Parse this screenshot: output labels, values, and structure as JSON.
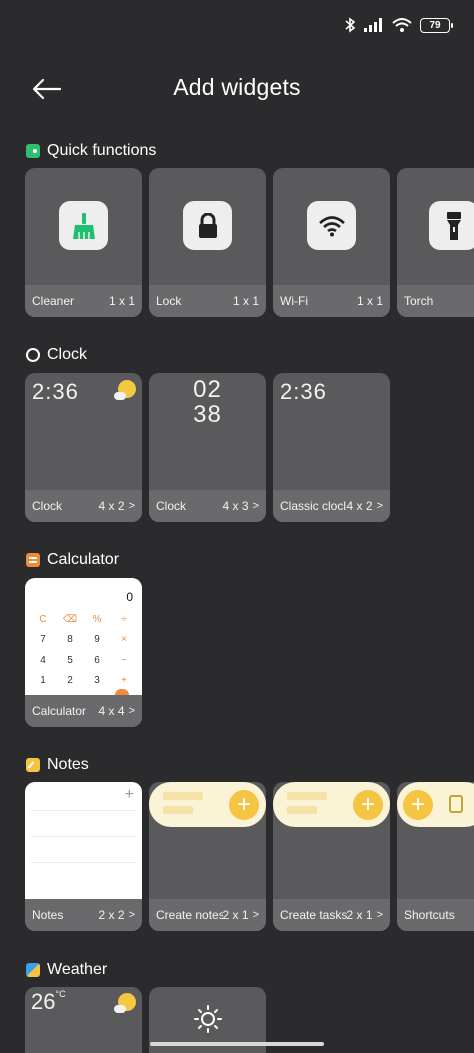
{
  "status_bar": {
    "battery": "79"
  },
  "header": {
    "title": "Add widgets"
  },
  "sections": {
    "quick": {
      "title": "Quick functions",
      "icon_color": "#2fbf71"
    },
    "clock": {
      "title": "Clock"
    },
    "calculator": {
      "title": "Calculator",
      "icon_color": "#f08a3c"
    },
    "notes": {
      "title": "Notes",
      "icon_color": "#f6c443"
    },
    "weather": {
      "title": "Weather"
    }
  },
  "quick_widgets": [
    {
      "name": "Cleaner",
      "size": "1 x 1",
      "icon": "broom-icon"
    },
    {
      "name": "Lock",
      "size": "1 x 1",
      "icon": "lock-icon"
    },
    {
      "name": "Wi-Fi",
      "size": "1 x 1",
      "icon": "wifi-icon"
    },
    {
      "name": "Torch",
      "size": "",
      "icon": "torch-icon"
    }
  ],
  "clock_widgets": [
    {
      "name": "Clock",
      "size": "4 x 2",
      "time": "2:36"
    },
    {
      "name": "Clock",
      "size": "4 x 3",
      "hour": "02",
      "minute": "38"
    },
    {
      "name": "Classic clocl",
      "size": "4 x 2",
      "time": "2:36"
    }
  ],
  "calculator_widgets": [
    {
      "name": "Calculator",
      "size": "4 x 4",
      "display": "0",
      "rows": [
        [
          "C",
          "⌫",
          "%",
          "÷"
        ],
        [
          "7",
          "8",
          "9",
          "×"
        ],
        [
          "4",
          "5",
          "6",
          "−"
        ],
        [
          "1",
          "2",
          "3",
          "+"
        ]
      ]
    }
  ],
  "notes_widgets": [
    {
      "name": "Notes",
      "size": "2 x 2"
    },
    {
      "name": "Create notes",
      "size": "2 x 1"
    },
    {
      "name": "Create tasks",
      "size": "2 x 1"
    },
    {
      "name": "Shortcuts",
      "size": ""
    }
  ],
  "weather_widgets": [
    {
      "temp": "26",
      "unit": "°C"
    }
  ],
  "chevron": ">"
}
